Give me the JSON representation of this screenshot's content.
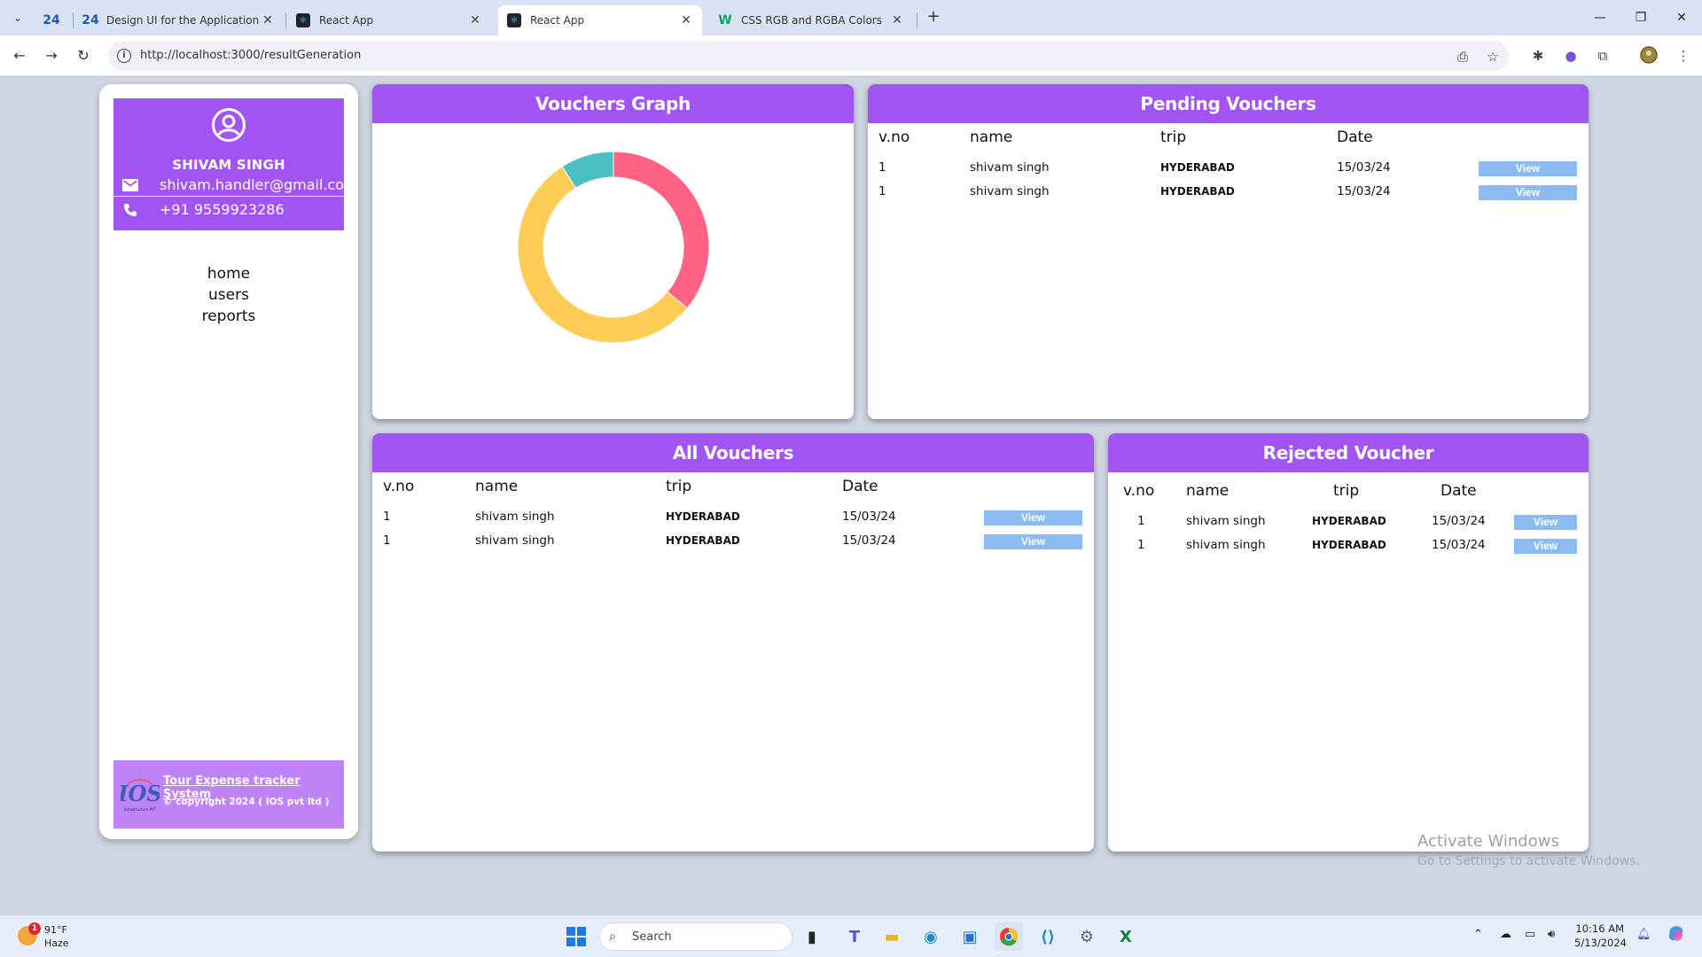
{
  "browser": {
    "tabs": [
      {
        "icon": "24",
        "title": ""
      },
      {
        "icon": "24",
        "title": "Design UI for the Application"
      },
      {
        "icon": "react",
        "title": "React App"
      },
      {
        "icon": "react",
        "title": "React App"
      },
      {
        "icon": "W",
        "title": "CSS RGB and RGBA Colors"
      }
    ],
    "tab_close": "✕",
    "new_tab": "+",
    "url": "http://localhost:3000/resultGeneration"
  },
  "sidebar": {
    "user_name": "SHIVAM SINGH",
    "email": "shivam.handler@gmail.com",
    "phone": "+91 9559923286",
    "nav": [
      "home",
      "users",
      "reports"
    ],
    "footer_title": "Tour Expense tracker System",
    "footer_copyright": "© copyright 2024 ( IOS pvt ltd )",
    "logo_text": "IOS",
    "logo_subtext": "Infrastructure PVT"
  },
  "graph": {
    "title": "Vouchers Graph"
  },
  "chart_data": {
    "type": "pie",
    "variant": "doughnut",
    "values": [
      36,
      55,
      9
    ],
    "colors": [
      "#ff6384",
      "#ffcd56",
      "#4bc0c0"
    ],
    "legend": "none"
  },
  "pending": {
    "title": "Pending Vouchers",
    "columns": [
      "v.no",
      "name",
      "trip",
      "Date"
    ],
    "rows": [
      {
        "vno": "1",
        "name": "shivam singh",
        "trip": "HYDERABAD",
        "date": "15/03/24",
        "action": "View"
      },
      {
        "vno": "1",
        "name": "shivam singh",
        "trip": "HYDERABAD",
        "date": "15/03/24",
        "action": "View"
      }
    ]
  },
  "all": {
    "title": "All Vouchers",
    "columns": [
      "v.no",
      "name",
      "trip",
      "Date"
    ],
    "rows": [
      {
        "vno": "1",
        "name": "shivam singh",
        "trip": "HYDERABAD",
        "date": "15/03/24",
        "action": "View"
      },
      {
        "vno": "1",
        "name": "shivam singh",
        "trip": "HYDERABAD",
        "date": "15/03/24",
        "action": "View"
      }
    ]
  },
  "rejected": {
    "title": "Rejected Voucher",
    "columns": [
      "v.no",
      "name",
      "trip",
      "Date"
    ],
    "rows": [
      {
        "vno": "1",
        "name": "shivam singh",
        "trip": "HYDERABAD",
        "date": "15/03/24",
        "action": "View"
      },
      {
        "vno": "1",
        "name": "shivam singh",
        "trip": "HYDERABAD",
        "date": "15/03/24",
        "action": "View"
      }
    ]
  },
  "watermark": {
    "line1": "Activate Windows",
    "line2": "Go to Settings to activate Windows."
  },
  "taskbar": {
    "temp": "91°F",
    "condition": "Haze",
    "weather_badge": "1",
    "search_placeholder": "Search",
    "time": "10:16 AM",
    "date": "5/13/2024"
  }
}
